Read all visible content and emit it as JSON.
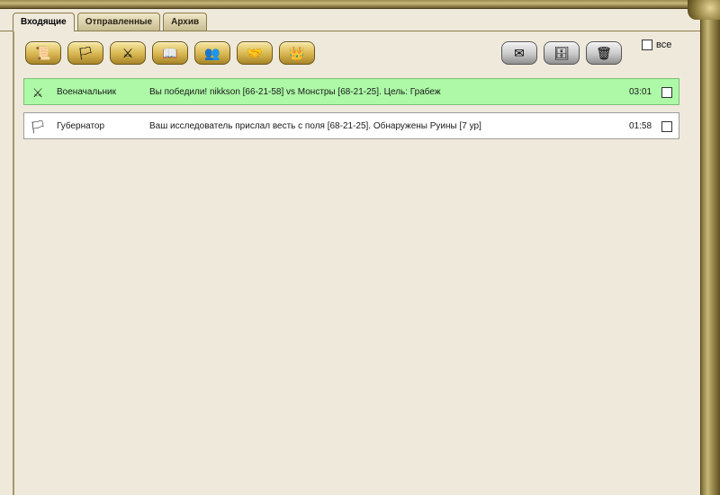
{
  "tabs": [
    {
      "label": "Входящие",
      "active": true
    },
    {
      "label": "Отправленные",
      "active": false
    },
    {
      "label": "Архив",
      "active": false
    }
  ],
  "toolbar": {
    "left_icons": [
      "scroll-icon",
      "flag-icon",
      "sword-shield-icon",
      "book-icon",
      "people-icon",
      "handshake-icon",
      "commander-icon"
    ],
    "right_icons": [
      "envelope-icon",
      "archive-icon",
      "trash-icon"
    ],
    "select_all_label": "все"
  },
  "messages": [
    {
      "sender": "Военачальник",
      "subject": "Вы победили! nikkson [66-21-58] vs Монстры [68-21-25]. Цель: Грабеж",
      "time": "03:01",
      "icon": "battle-icon",
      "highlight_color": "#adf9a7"
    },
    {
      "sender": "Губернатор",
      "subject": "Ваш исследователь прислал весть с поля [68-21-25]. Обнаружены Руины [7 ур]",
      "time": "01:58",
      "icon": "flag-icon",
      "highlight_color": "#ffffff"
    }
  ]
}
